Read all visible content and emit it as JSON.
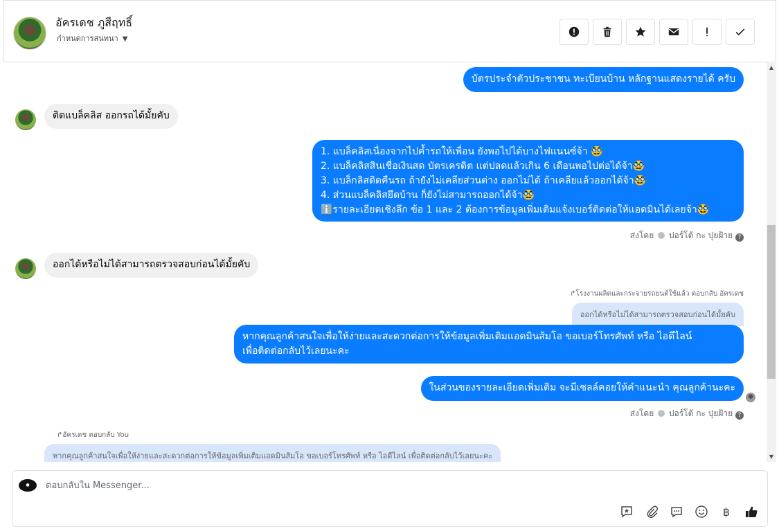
{
  "header": {
    "contact_name": "อัครเดช ภูสีฤทธิ์",
    "subtitle": "กำหนดการสนทนา"
  },
  "thread": {
    "messages": [
      {
        "id": "m1",
        "direction": "out",
        "text": "บัตรประจำตัวประชาชน ทะเบียนบ้าน หลักฐานแสดงรายได้ ครับ"
      },
      {
        "id": "m2",
        "direction": "in",
        "text": "ติดแบล็คลิส ออกรถได้มั้ยคับ"
      },
      {
        "id": "m3",
        "direction": "out",
        "lines": [
          "1. แบล็คลิสเนื่องจากไปค้ำรถให้เพื่อน ยังพอไปได้บางไฟแนนซ์จ้า 🥸",
          "2. แบล็คลิสสินเชื่อเงินสด บัตรเครดิต แต่ปลดแล้วเกิน 6 เดือนพอไปต่อได้จ้า🥸",
          "3. แบล็กลิสติดคืนรถ ถ้ายังไม่เคลียส่วนต่าง ออกไม่ได้ ถ้าเคลียแล้วออกได้จ้า🥸",
          "4. ส่วนแบล็คลิสยึดบ้าน ก็ยังไม่สามารถออกได้จ้า🥸",
          "ℹ️รายละเอียดเชิงลึก ข้อ 1 และ 2 ต้องการข้อมูลเพิ่มเติมแจ้งเบอร์ติดต่อให้แอดมินได้เลยจ้า🥸"
        ]
      },
      {
        "id": "m4",
        "direction": "in",
        "text": "ออกได้หรือไม่ได้สามารถตรวจสอบก่อนได้มั้ยคับ"
      },
      {
        "id": "m5",
        "direction": "out",
        "lines": [
          "หากคุณลูกค้าสนใจเพื่อให้ง่ายและสะดวกต่อการให้ข้อมูลเพิ่มเติมแอดมินส้มโอ ขอเบอร์โทรศัพท์ หรือ ไอดีไลน์",
          "เพื่อติดต่อกลับไว้เลยนะคะ"
        ]
      },
      {
        "id": "m6",
        "direction": "out",
        "text": "ในส่วนของรายละเอียดเพิ่มเติม จะมีเซลล์คอยให้คำแนะนำ คุณลูกค้านะคะ"
      }
    ],
    "sent_by_1": {
      "prefix": "ส่งโดย",
      "name": "ปอร์โต้ กะ ปุยฝ้าย"
    },
    "reply_1": {
      "label": "โรงงานผลิตและกระจายรถยนต์ใช้แล้ว ตอบกลับ อัครเดช",
      "quote": "ออกได้หรือไม่ได้สามารถตรวจสอบก่อนได้มั้ยคับ"
    },
    "sent_by_2": {
      "prefix": "ส่งโดย",
      "name": "ปอร์โต้ กะ ปุยฝ้าย"
    },
    "reply_2": {
      "label": "อัครเดช ตอบกลับ You",
      "quote": "หากคุณลูกค้าสนใจเพื่อให้ง่ายและสะดวกต่อการให้ข้อมูลเพิ่มเติมแอดมินส้มโอ ขอเบอร์โทรศัพท์ หรือ ไอดีไลน์ เพื่อติดต่อกลับไว้เลยนะคะ"
    }
  },
  "composer": {
    "placeholder": "ตอบกลับใน Messenger...",
    "currency_symbol": "฿"
  },
  "colors": {
    "outgoing_bubble": "#0a7cff",
    "incoming_bubble": "#f0f0f0",
    "quote_bubble": "#d8e6fb"
  }
}
